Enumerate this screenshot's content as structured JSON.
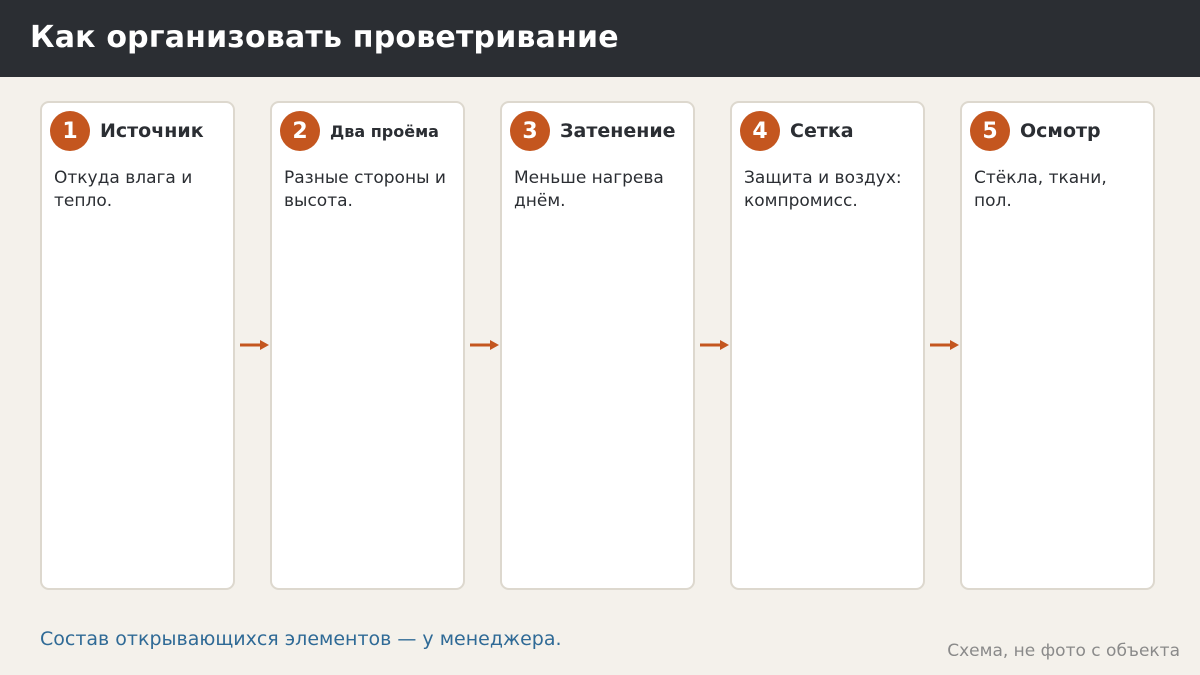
{
  "header": {
    "title": "Как организовать проветривание"
  },
  "steps": [
    {
      "number": "1",
      "title": "Источник",
      "text": "Откуда влага и тепло."
    },
    {
      "number": "2",
      "title": "Два проёма",
      "text": "Разные стороны и высота."
    },
    {
      "number": "3",
      "title": "Затенение",
      "text": "Меньше нагрева днём."
    },
    {
      "number": "4",
      "title": "Сетка",
      "text": "Защита и воздух: компромисс."
    },
    {
      "number": "5",
      "title": "Осмотр",
      "text": "Стёкла, ткани, пол."
    }
  ],
  "footer": {
    "note": "Состав открывающихся элементов — у менеджера.",
    "caption": "Схема, не фото с объекта"
  },
  "colors": {
    "header_bg": "#2b2e33",
    "accent": "#c4561f",
    "note_text": "#2f6a96",
    "background": "#f4f1eb"
  }
}
